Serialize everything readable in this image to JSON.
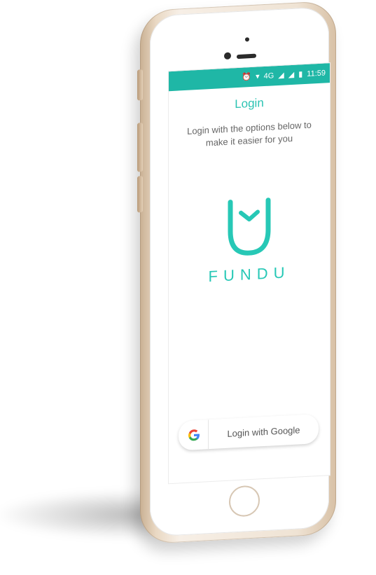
{
  "status_bar": {
    "time": "11:59",
    "network": "4G",
    "color": "#1fb7a6",
    "icons": [
      "alarm-icon",
      "wifi-icon",
      "signal-icon",
      "signal-icon",
      "battery-icon"
    ]
  },
  "screen": {
    "title": "Login",
    "subtitle": "Login with the options below to make it easier for you",
    "brand_name": "FUNDU",
    "accent_color": "#27c8b6"
  },
  "actions": {
    "google_login_label": "Login with Google"
  }
}
